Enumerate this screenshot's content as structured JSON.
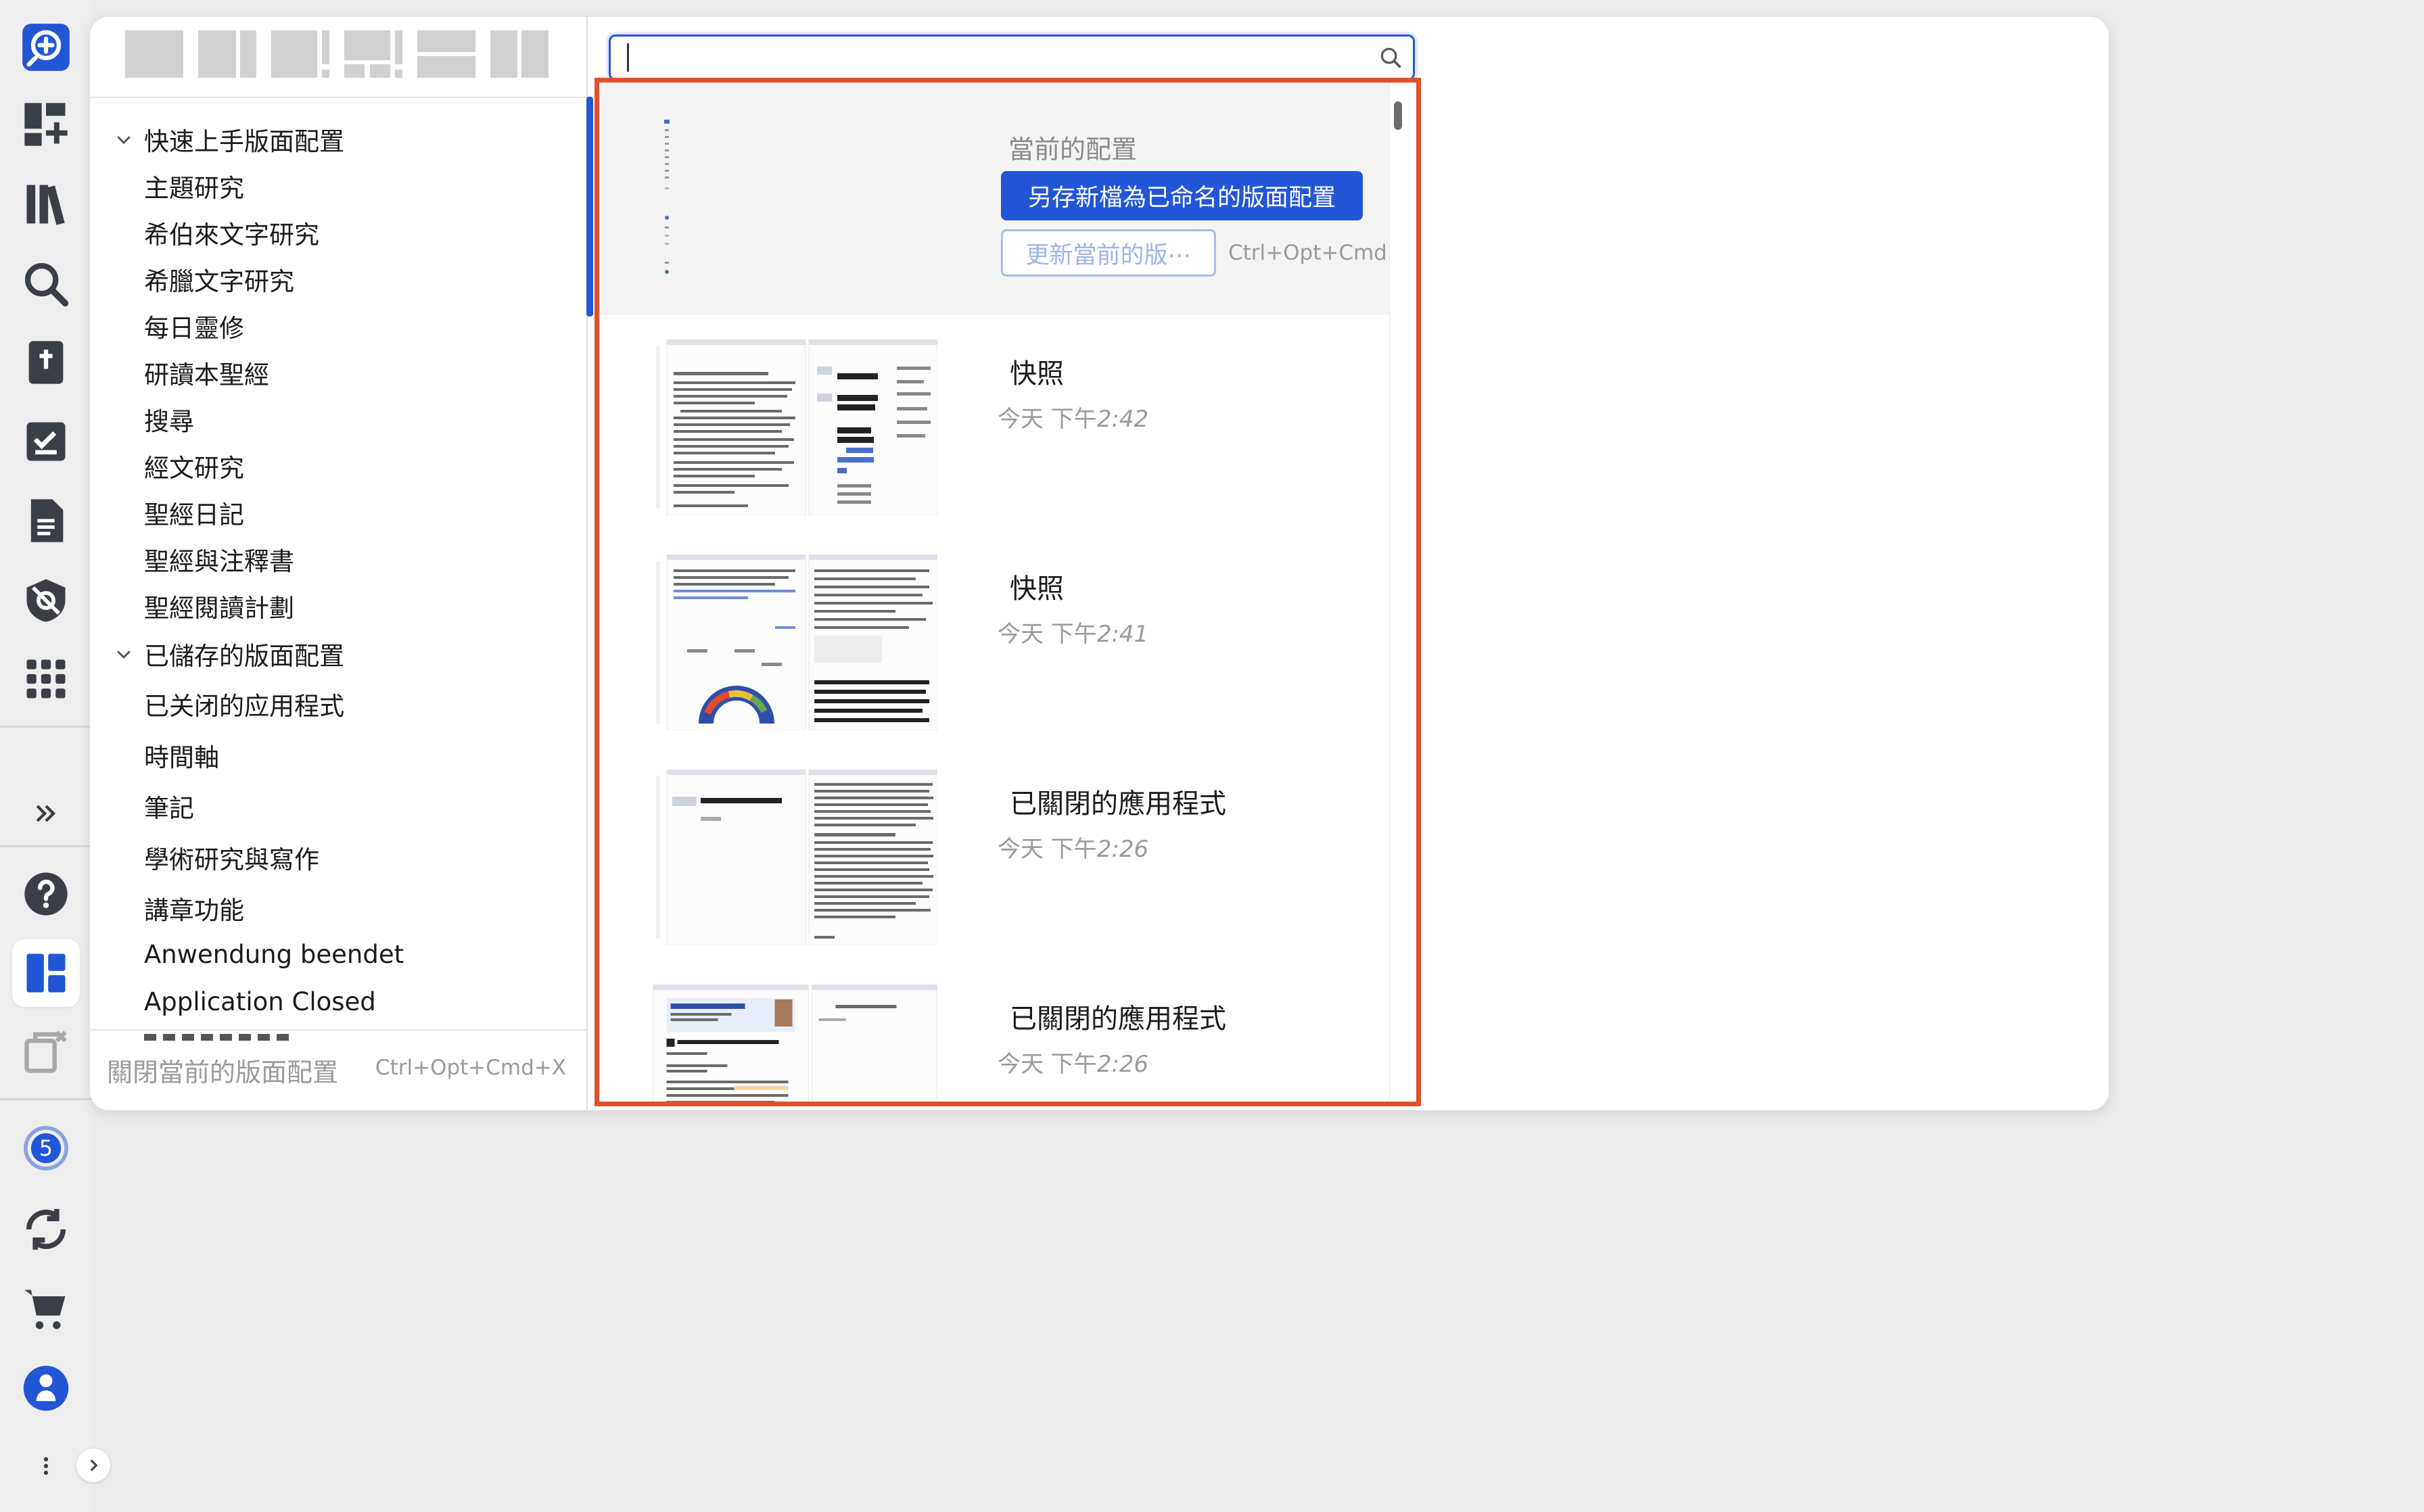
{
  "rail": {
    "items": [
      {
        "name": "search-add-icon",
        "active": false
      },
      {
        "name": "dashboard-add-icon",
        "active": false
      },
      {
        "name": "library-icon",
        "active": false
      },
      {
        "name": "search-icon",
        "active": false
      },
      {
        "name": "bible-icon",
        "active": false
      },
      {
        "name": "checklist-icon",
        "active": false
      },
      {
        "name": "document-icon",
        "active": false
      },
      {
        "name": "shield-eye-icon",
        "active": false
      },
      {
        "name": "apps-grid-icon",
        "active": false
      },
      {
        "name": "expand-chevrons-icon",
        "active": false
      },
      {
        "name": "help-icon",
        "active": false
      },
      {
        "name": "layouts-icon",
        "active": true
      },
      {
        "name": "close-windows-icon",
        "active": false
      },
      {
        "name": "notifications-icon",
        "badge": "5"
      },
      {
        "name": "sync-icon",
        "active": false
      },
      {
        "name": "cart-icon",
        "active": false
      },
      {
        "name": "user-icon",
        "active": false
      },
      {
        "name": "more-icon",
        "active": false
      }
    ],
    "accent_color": "#2356d6",
    "icon_color": "#3a3f47"
  },
  "layout_presets": [
    "single",
    "two-column-wide",
    "two-column-alert",
    "grid-alert",
    "stacked-rows",
    "two-column"
  ],
  "tree": {
    "groups": [
      {
        "label": "快速上手版面配置",
        "expanded": true,
        "children": [
          "主題研究",
          "希伯來文字研究",
          "希臘文字研究",
          "每日靈修",
          "研讀本聖經",
          "搜尋",
          "經文研究",
          "聖經日記",
          "聖經與注釋書",
          "聖經閱讀計劃"
        ]
      },
      {
        "label": "已儲存的版面配置",
        "expanded": true,
        "children": [
          "已关闭的应用程式",
          "時間軸",
          "筆記",
          "學術研究與寫作",
          "講章功能",
          "Anwendung beendet",
          "Application Closed"
        ]
      }
    ]
  },
  "footer": {
    "close_label": "關閉當前的版面配置",
    "close_shortcut": "Ctrl+Opt+Cmd+X"
  },
  "search": {
    "placeholder": "",
    "value": ""
  },
  "current": {
    "label": "當前的配置",
    "save_new_label": "另存新檔為已命名的版面配置",
    "update_label": "更新當前的版⋯",
    "update_shortcut": "Ctrl+Opt+Cmd+L"
  },
  "items": [
    {
      "title": "快照",
      "time_prefix": "今天 下午",
      "time": "2:42"
    },
    {
      "title": "快照",
      "time_prefix": "今天 下午",
      "time": "2:41"
    },
    {
      "title": "已關閉的應用程式",
      "time_prefix": "今天 下午",
      "time": "2:26"
    },
    {
      "title": "已關閉的應用程式",
      "time_prefix": "今天 下午",
      "time": "2:26"
    }
  ],
  "highlight_color": "#e0502b"
}
